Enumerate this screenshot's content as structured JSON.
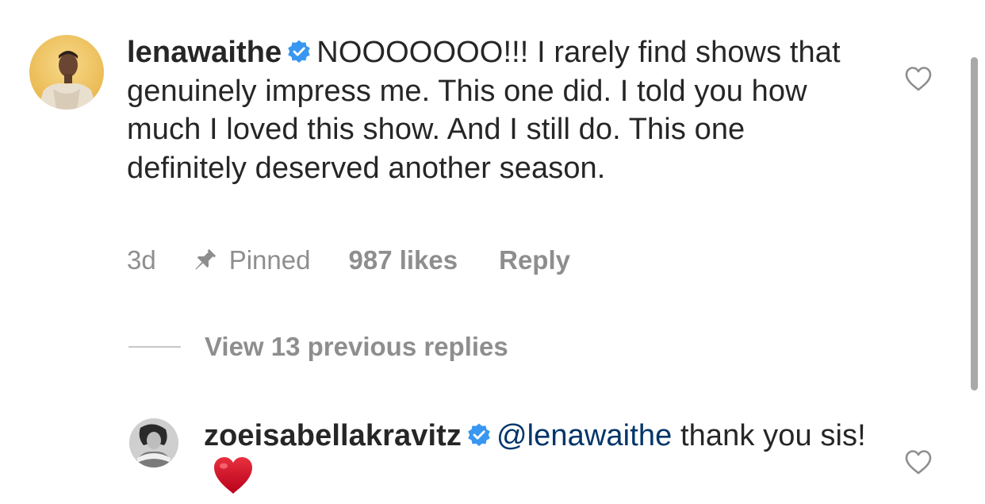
{
  "comments": [
    {
      "username": "lenawaithe",
      "verified": true,
      "text": "NOOOOOOO!!! I rarely find shows that genuinely impress me. This one did. I told you how much I loved this show. And I still do. This one definitely deserved another season.",
      "time": "3d",
      "pinned_label": "Pinned",
      "likes": "987 likes",
      "reply_label": "Reply",
      "like_icon": "heart-outline-icon"
    }
  ],
  "replies_toggle": {
    "label": "View 13 previous replies"
  },
  "reply": {
    "username": "zoeisabellakravitz",
    "verified": true,
    "mention": "@lenawaithe",
    "text": " thank you sis!",
    "emoji": "red-heart-emoji",
    "like_icon": "heart-outline-icon"
  },
  "colors": {
    "text": "#262626",
    "secondary": "#8e8e8e",
    "mention": "#003569",
    "verified_badge": "#3897f0",
    "heart_emoji": "#d0021b",
    "avatar_main_bg": "#f2c86a"
  }
}
